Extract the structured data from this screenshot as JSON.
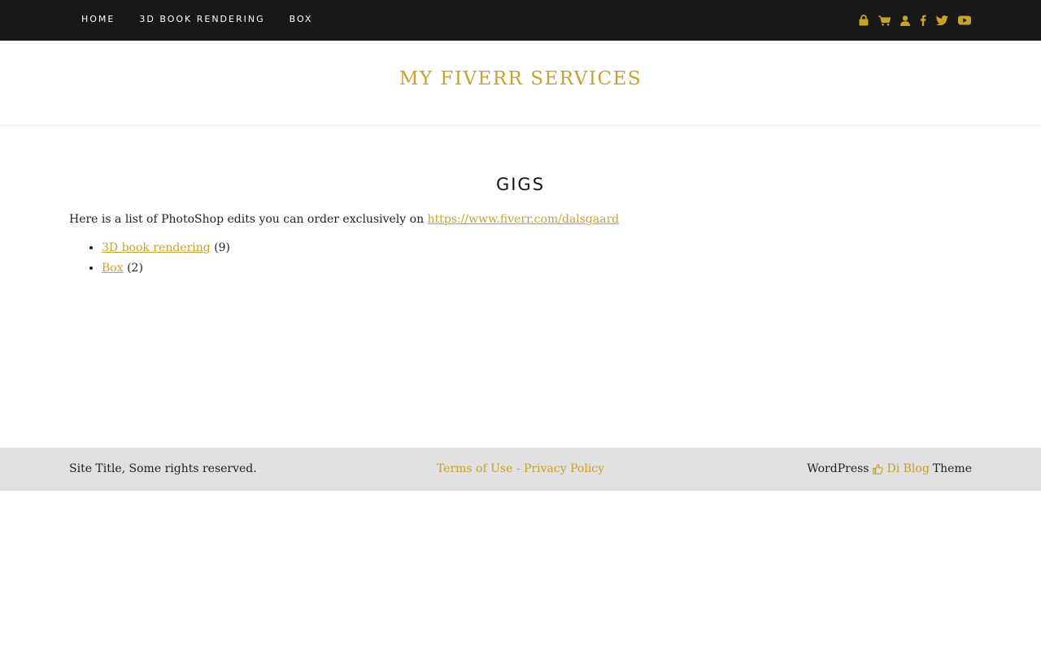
{
  "nav": {
    "items": [
      {
        "label": "HOME"
      },
      {
        "label": "3D BOOK RENDERING"
      },
      {
        "label": "BOX"
      }
    ],
    "social_icons": [
      "lock-icon",
      "cart-icon",
      "user-icon",
      "facebook-icon",
      "twitter-icon",
      "youtube-icon"
    ]
  },
  "header": {
    "site_title": "MY FIVERR SERVICES"
  },
  "main": {
    "page_title": "GIGS",
    "intro_text": "Here is a list of PhotoShop edits you can order exclusively on ",
    "intro_link": "https://www.fiverr.com/dalsgaard",
    "gigs": [
      {
        "label": "3D book rendering",
        "count": "(9)"
      },
      {
        "label": "Box",
        "count": "(2)"
      }
    ]
  },
  "footer": {
    "copyright": "Site Title, Some rights reserved.",
    "links": "Terms of Use - Privacy Policy",
    "credit_prefix": "WordPress",
    "credit_link": "Di Blog",
    "credit_suffix": "Theme"
  },
  "colors": {
    "accent": "#c9a22c",
    "topbar_bg": "#181818",
    "footer_bg": "#e0e0e0"
  }
}
